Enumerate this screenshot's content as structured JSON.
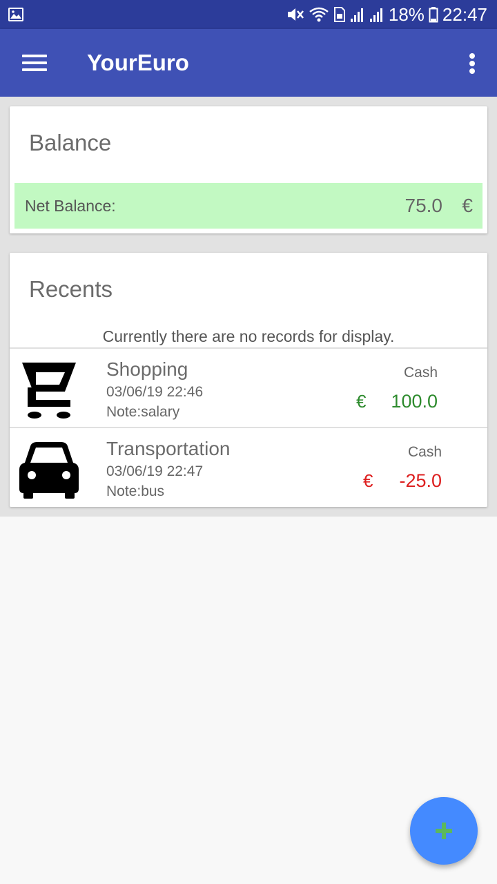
{
  "status_bar": {
    "battery_text": "18%",
    "time": "22:47",
    "icons": [
      "gallery-icon",
      "mute-icon",
      "wifi-icon",
      "sim-icon",
      "signal-icon",
      "signal-roaming-icon",
      "battery-icon"
    ]
  },
  "app_bar": {
    "title": "YourEuro",
    "menu_icon": "hamburger-menu-icon",
    "overflow_icon": "more-vert-icon",
    "color": "#3f51b5"
  },
  "balance_card": {
    "title": "Balance",
    "net_label": "Net Balance:",
    "net_value": "75.0",
    "currency": "€",
    "highlight_color": "#c2f9c2"
  },
  "recents_card": {
    "title": "Recents",
    "empty_message": "Currently there are no records for display.",
    "records": [
      {
        "icon": "shopping-cart-icon",
        "category": "Shopping",
        "datetime": "03/06/19 22:46",
        "note": "Note:salary",
        "account": "Cash",
        "currency": "€",
        "amount": "100.0",
        "amount_color": "#2e8b2e"
      },
      {
        "icon": "car-icon",
        "category": "Transportation",
        "datetime": "03/06/19 22:47",
        "note": "Note:bus",
        "account": "Cash",
        "currency": "€",
        "amount": "-25.0",
        "amount_color": "#dd1f1f"
      }
    ]
  },
  "fab": {
    "icon": "add-icon",
    "color": "#448aff"
  }
}
